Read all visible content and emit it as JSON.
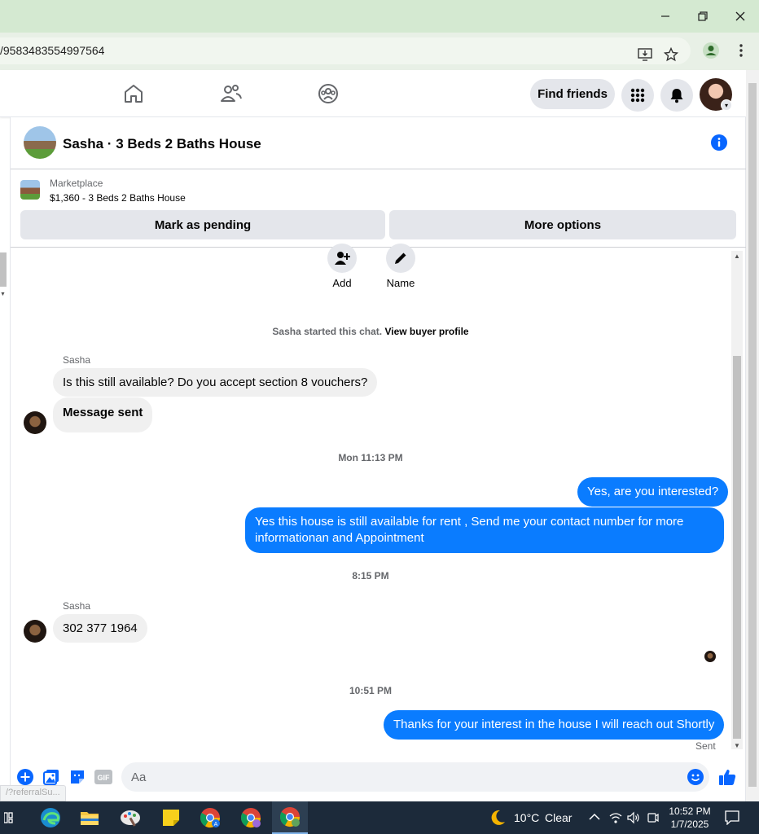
{
  "browser": {
    "url": "/9583483554997564",
    "window_buttons": [
      "minimize-icon",
      "restore-icon",
      "close-icon"
    ]
  },
  "header": {
    "find_friends_label": "Find friends",
    "nav_icons": [
      "home-icon",
      "friends-icon",
      "groups-icon"
    ]
  },
  "chat": {
    "title": "Sasha · 3 Beds 2 Baths House",
    "listing": {
      "category": "Marketplace",
      "price_title": "$1,360 - 3 Beds 2 Baths House",
      "mark_pending_label": "Mark as pending",
      "more_options_label": "More options"
    },
    "actions": {
      "add_label": "Add",
      "name_label": "Name"
    },
    "started_text": "Sasha started this chat.",
    "view_profile_label": "View buyer profile",
    "messages": [
      {
        "sender": "Sasha",
        "text": "Is this still available? Do you accept section 8 vouchers?"
      },
      {
        "text": "Message sent"
      },
      {
        "timestamp": "Mon 11:13 PM"
      },
      {
        "text": "Yes, are you interested?"
      },
      {
        "text": "Yes this house is still available for rent , Send me your contact number for more informationan and Appointment"
      },
      {
        "timestamp": "8:15 PM"
      },
      {
        "sender": "Sasha",
        "text": "302 377 1964"
      },
      {
        "timestamp": "10:51 PM"
      },
      {
        "text": "Thanks for your interest in the house I will reach out Shortly"
      }
    ],
    "sent_status": "Sent",
    "composer_placeholder": "Aa"
  },
  "status_bar_url": "/?referralSu...",
  "taskbar": {
    "weather_temp": "10°C",
    "weather_condition": "Clear",
    "time": "10:52 PM",
    "date": "1/7/2025"
  },
  "colors": {
    "accent": "#0a7cff",
    "fb_blue": "#0866ff",
    "titlebar": "#d4e9d1"
  }
}
